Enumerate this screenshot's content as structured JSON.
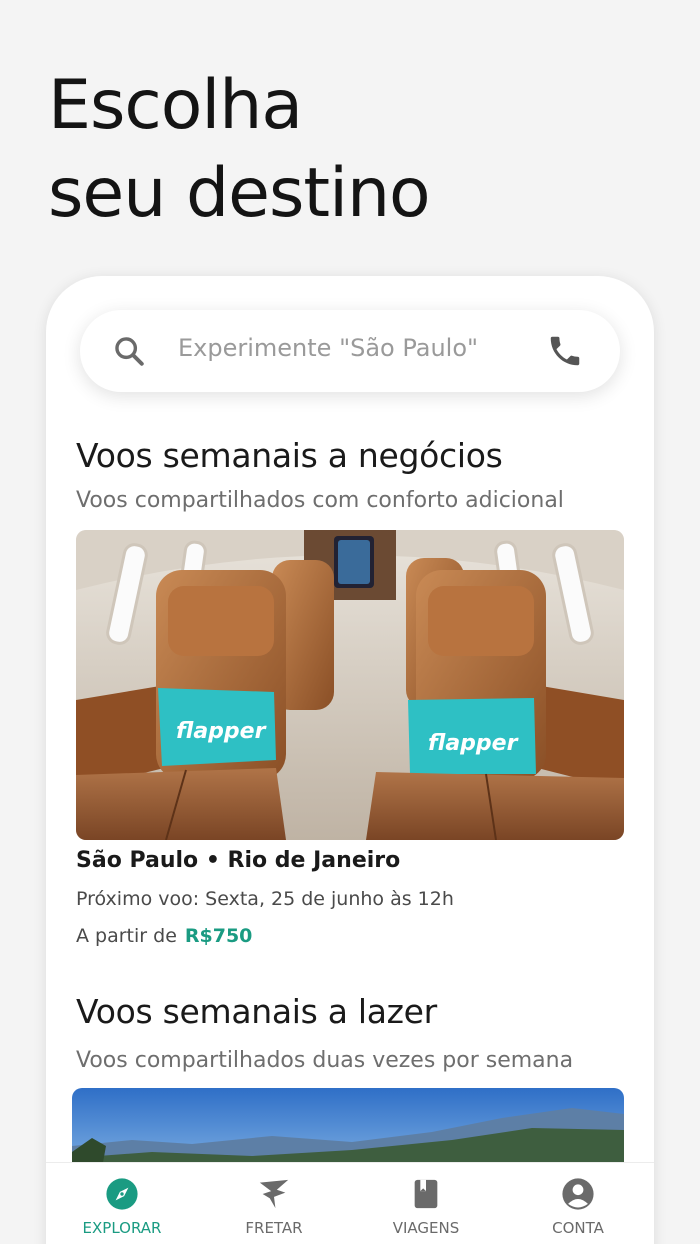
{
  "headline": {
    "line1": "Escolha",
    "line2": "seu destino"
  },
  "search": {
    "placeholder": "Experimente \"São Paulo\""
  },
  "business": {
    "title": "Voos semanais a negócios",
    "subtitle": "Voos compartilhados com conforto adicional",
    "pillow_brand": "flapper",
    "route": "São Paulo • Rio de Janeiro",
    "next_flight": "Próximo voo: Sexta, 25 de junho às 12h",
    "price_prefix": "A partir de",
    "price": "R$750"
  },
  "leisure": {
    "title": "Voos semanais a lazer",
    "subtitle": "Voos compartilhados duas vezes por semana"
  },
  "nav": {
    "items": [
      {
        "label": "EXPLORAR",
        "icon": "compass-icon",
        "active": true
      },
      {
        "label": "FRETAR",
        "icon": "plane-icon",
        "active": false
      },
      {
        "label": "VIAGENS",
        "icon": "book-icon",
        "active": false
      },
      {
        "label": "CONTA",
        "icon": "account-icon",
        "active": false
      }
    ]
  },
  "colors": {
    "accent": "#1a9b82",
    "background": "#f4f4f4",
    "text": "#1a1a1a"
  }
}
